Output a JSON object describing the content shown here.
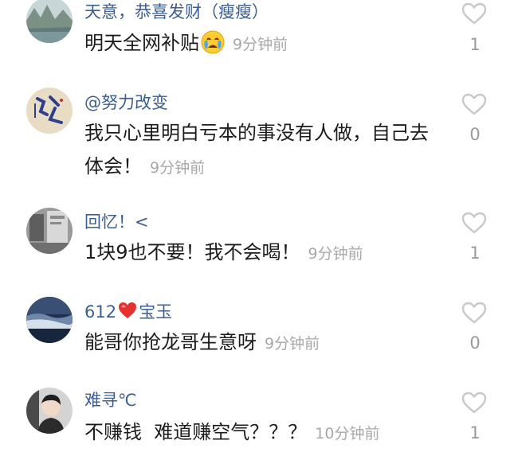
{
  "comments": [
    {
      "user": "天意，恭喜发财（瘦瘦）",
      "text": "明天全网补贴",
      "emoji": "crying-face",
      "time": "9分钟前",
      "likes": "1"
    },
    {
      "user": "@努力改变",
      "text": "我只心里明白亏本的事没有人做，自己去体会！",
      "time": "9分钟前",
      "likes": "0"
    },
    {
      "user": "回忆！<",
      "text": "1块9也不要！我不会喝！",
      "time": "9分钟前",
      "likes": "1"
    },
    {
      "user_prefix": "612",
      "user_suffix": "宝玉",
      "user_heart_color": "#e5312f",
      "text": "能哥你抢龙哥生意呀",
      "time": "9分钟前",
      "likes": "0"
    },
    {
      "user": "难寻℃",
      "text": "不赚钱  难道赚空气？？？",
      "time": "10分钟前",
      "likes": "1"
    }
  ],
  "icons": {
    "like": "heart-outline-icon"
  },
  "colors": {
    "username": "#3b5f93",
    "text": "#1c1c1c",
    "meta": "#a8a8a8"
  }
}
